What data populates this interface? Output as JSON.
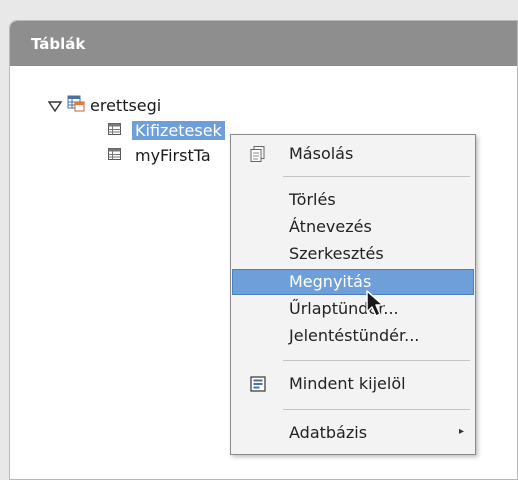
{
  "panel": {
    "title": "Táblák"
  },
  "tree": {
    "database": "erettsegi",
    "tables": [
      {
        "label": "Kifizetesek",
        "selected": true
      },
      {
        "label": "myFirstTa"
      }
    ]
  },
  "context_menu": {
    "items": [
      {
        "label": "Másolás",
        "icon": "copy-icon"
      },
      {
        "label": "Törlés"
      },
      {
        "label": "Átnevezés"
      },
      {
        "label": "Szerkesztés"
      },
      {
        "label": "Megnyitás",
        "highlighted": true
      },
      {
        "label": "Űrlaptündér..."
      },
      {
        "label": "Jelentéstündér..."
      },
      {
        "label": "Mindent kijelöl",
        "icon": "select-all-icon"
      },
      {
        "label": "Adatbázis",
        "submenu": true
      }
    ]
  },
  "colors": {
    "header": "#8e8e8e",
    "selection": "#6f9fd8",
    "menu_bg": "#f3f3f3"
  }
}
